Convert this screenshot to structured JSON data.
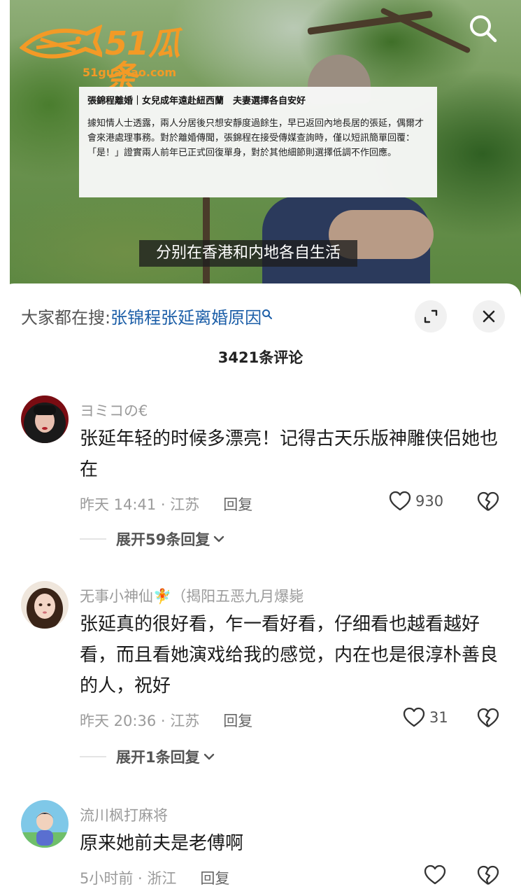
{
  "video": {
    "logo_text": "51瓜条",
    "logo_url": "51guatiao.com",
    "news_title": "張錦程離婚｜女兒成年遠赴紐西蘭　夫妻選擇各自安好",
    "news_body": "據知情人士透露，兩人分居後只想安靜度過餘生，早已返回內地長居的張延，偶爾才會來港處理事務。對於離婚傳聞，張錦程在接受傳媒查詢時，僅以短訊簡單回覆：「是！」證實兩人前年已正式回復單身，對於其他細節則選擇低調不作回應。",
    "subtitle": "分别在香港和内地各自生活",
    "brand_color": "#f39a26"
  },
  "sheet": {
    "search_prefix": "大家都在搜:",
    "search_term": "张锦程张延离婚原因",
    "search_suffix_icon": "search-icon",
    "comment_count": "3421条评论"
  },
  "comments": [
    {
      "username": "ヨミコの€",
      "text": "张延年轻的时候多漂亮！记得古天乐版神雕侠侣她也在",
      "time_location": "昨天 14:41 · 江苏",
      "reply_label": "回复",
      "likes": "930",
      "expand_label": "展开59条回复"
    },
    {
      "username": "无事小神仙🧚（揭阳五恶九月爆毙",
      "text": "张延真的很好看，乍一看好看，仔细看也越看越好看，而且看她演戏给我的感觉，内在也是很淳朴善良的人，祝好",
      "time_location": "昨天 20:36 · 江苏",
      "reply_label": "回复",
      "likes": "31",
      "expand_label": "展开1条回复"
    },
    {
      "username": "流川枫打麻将",
      "text": "原来她前夫是老傅啊",
      "time_location": "5小时前 · 浙江",
      "reply_label": "回复",
      "likes": ""
    }
  ]
}
